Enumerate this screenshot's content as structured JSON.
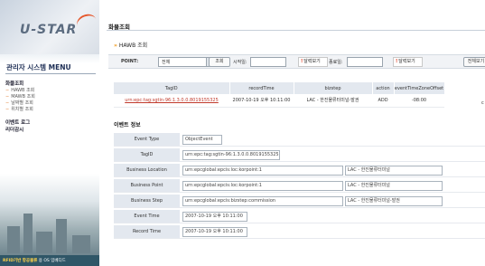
{
  "sidebar": {
    "logo": "U-STAR",
    "menu_title": "관리자 시스템 MENU",
    "sections": [
      {
        "label": "화물조회",
        "items": [
          "HAWB 조회",
          "MAWB 조회",
          "날짜별 조회",
          "위치별 조회"
        ]
      },
      {
        "label": "이벤트 로그",
        "items": []
      },
      {
        "label": "리더감시",
        "items": []
      }
    ],
    "footer_highlight": "RFID기반 항공물류",
    "footer_rest": "용 OS 임베디드"
  },
  "page": {
    "title": "화물조회",
    "subtitle": "HAWB 조회"
  },
  "filter": {
    "point_label": "POINT:",
    "point_value": "전체",
    "search_button": "조회",
    "start_label": "시작일:",
    "start_calendar": "달력보기",
    "end_label": "종료일:",
    "end_calendar": "달력보기",
    "right_button": "전체보기"
  },
  "list": {
    "headers": [
      "TagID",
      "recordTime",
      "bizstep",
      "action",
      "eventTimeZoneOffset"
    ],
    "rows": [
      [
        "urn:epc:tag:sgtin-96:1.3.0.0.8019155325",
        "2007-10-19 오후 10:11:00",
        "LAC - 한진물류터미널-발권",
        "ADD",
        "-08:00"
      ]
    ],
    "trailing_char": "c"
  },
  "event": {
    "title": "이벤트 정보",
    "rows": [
      {
        "label": "Event Type",
        "value": "ObjectEvent"
      },
      {
        "label": "TagID",
        "value": "urn:epc:tag:sgtin-96:1.3.0.0.8019155325"
      },
      {
        "label": "Business Location",
        "value": "urn:epcglobal:epcis:loc:korpoint:1",
        "value2": "LAC - 한진물류터미널"
      },
      {
        "label": "Business Point",
        "value": "urn:epcglobal:epcis:loc:korpoint:1",
        "value2": "LAC - 한진물류터미널"
      },
      {
        "label": "Business Step",
        "value": "urn:epcglobal:epcis:bizstep:commission",
        "value2": "LAC - 한진물류터미널-발권"
      },
      {
        "label": "Event Time",
        "value": "2007-10-19 오후 10:11:00"
      },
      {
        "label": "Record Time",
        "value": "2007-10-19 오후 10:11:00"
      }
    ]
  }
}
